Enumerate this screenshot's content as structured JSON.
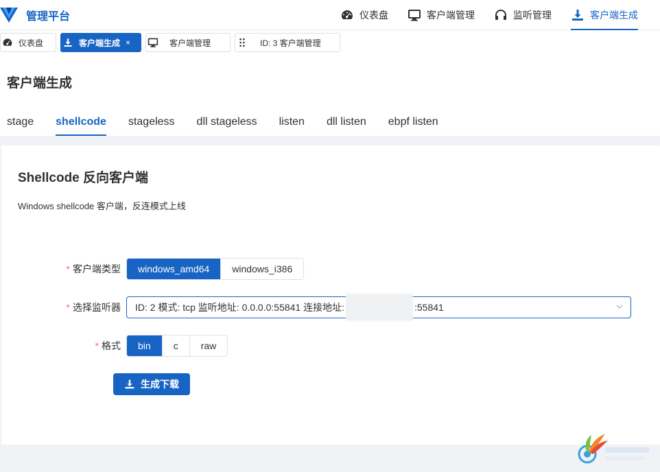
{
  "app": {
    "title": "管理平台"
  },
  "topnav": [
    {
      "label": "仪表盘",
      "icon": "dashboard-icon",
      "active": false
    },
    {
      "label": "客户端管理",
      "icon": "monitor-icon",
      "active": false
    },
    {
      "label": "监听管理",
      "icon": "headphones-icon",
      "active": false
    },
    {
      "label": "客户端生成",
      "icon": "download-icon",
      "active": true
    }
  ],
  "pagetabs": [
    {
      "label": "仪表盘",
      "icon": "dashboard-icon",
      "active": false,
      "closable": false
    },
    {
      "label": "客户端生成",
      "icon": "download-icon",
      "active": true,
      "closable": true,
      "close": "×"
    },
    {
      "label": "客户端管理",
      "icon": "monitor-icon",
      "active": false,
      "closable": false
    },
    {
      "label": "ID: 3 客户端管理",
      "icon": "grip-icon",
      "active": false,
      "closable": false
    }
  ],
  "page": {
    "title": "客户端生成"
  },
  "subtabs": [
    {
      "label": "stage",
      "active": false
    },
    {
      "label": "shellcode",
      "active": true
    },
    {
      "label": "stageless",
      "active": false
    },
    {
      "label": "dll stageless",
      "active": false
    },
    {
      "label": "listen",
      "active": false
    },
    {
      "label": "dll listen",
      "active": false
    },
    {
      "label": "ebpf listen",
      "active": false
    }
  ],
  "card": {
    "title": "Shellcode 反向客户端",
    "desc": "Windows shellcode 客户端，反连模式上线"
  },
  "form": {
    "required_mark": "*",
    "client_type": {
      "label": "客户端类型",
      "options": [
        "windows_amd64",
        "windows_i386"
      ],
      "selected": "windows_amd64"
    },
    "listener": {
      "label": "选择监听器",
      "value_prefix": "ID: 2 模式: tcp 监听地址: 0.0.0.0:55841 连接地址:",
      "value_suffix": ":55841"
    },
    "format": {
      "label": "格式",
      "options": [
        "bin",
        "c",
        "raw"
      ],
      "selected": "bin"
    },
    "generate_label": "生成下载"
  },
  "colors": {
    "accent": "#1764c4",
    "required": "#f56c6c"
  }
}
